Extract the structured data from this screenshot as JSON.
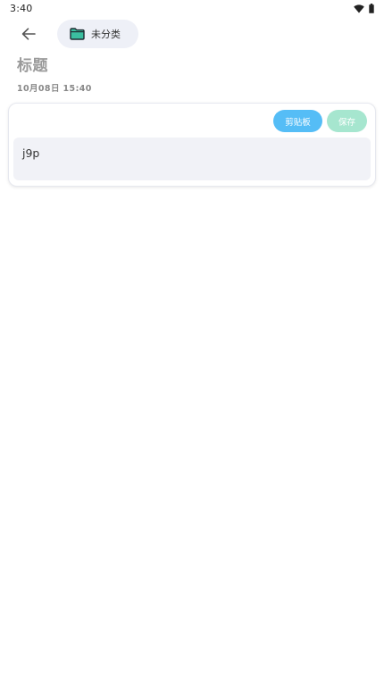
{
  "status_bar": {
    "time": "3:40"
  },
  "header": {
    "category_label": "未分类"
  },
  "note": {
    "title": "标题",
    "date": "10月08日 15:40",
    "content": "j9p"
  },
  "actions": {
    "clipboard_label": "剪贴板",
    "save_label": "保存"
  },
  "colors": {
    "clipboard_button": "#55bdf6",
    "save_button": "#a6e6cf",
    "folder_icon": "#3bbfa0",
    "chip_background": "#eef0f7",
    "content_background": "#f1f2f7"
  },
  "icons": [
    "back-arrow-icon",
    "folder-icon",
    "wifi-icon",
    "battery-icon"
  ]
}
